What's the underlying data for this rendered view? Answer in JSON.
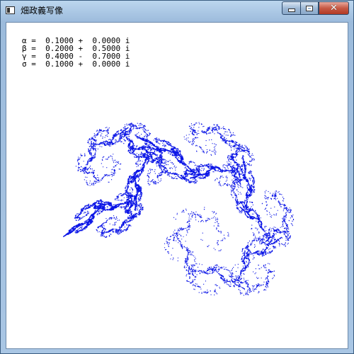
{
  "window": {
    "title": "畑政義写像",
    "controls": {
      "minimize": "minimize",
      "maximize": "maximize",
      "close": "close"
    }
  },
  "parameters": [
    {
      "symbol": "α",
      "real": "0.1000",
      "sign": "+",
      "imag": "0.0000",
      "unit": "i"
    },
    {
      "symbol": "β",
      "real": "0.2000",
      "sign": "+",
      "imag": "0.5000",
      "unit": "i"
    },
    {
      "symbol": "γ",
      "real": "0.4000",
      "sign": "-",
      "imag": "0.7000",
      "unit": "i"
    },
    {
      "symbol": "σ",
      "real": "0.1000",
      "sign": "+",
      "imag": "0.0000",
      "unit": "i"
    }
  ],
  "fractal": {
    "color": "#0a14e6",
    "background": "#ffffff"
  }
}
